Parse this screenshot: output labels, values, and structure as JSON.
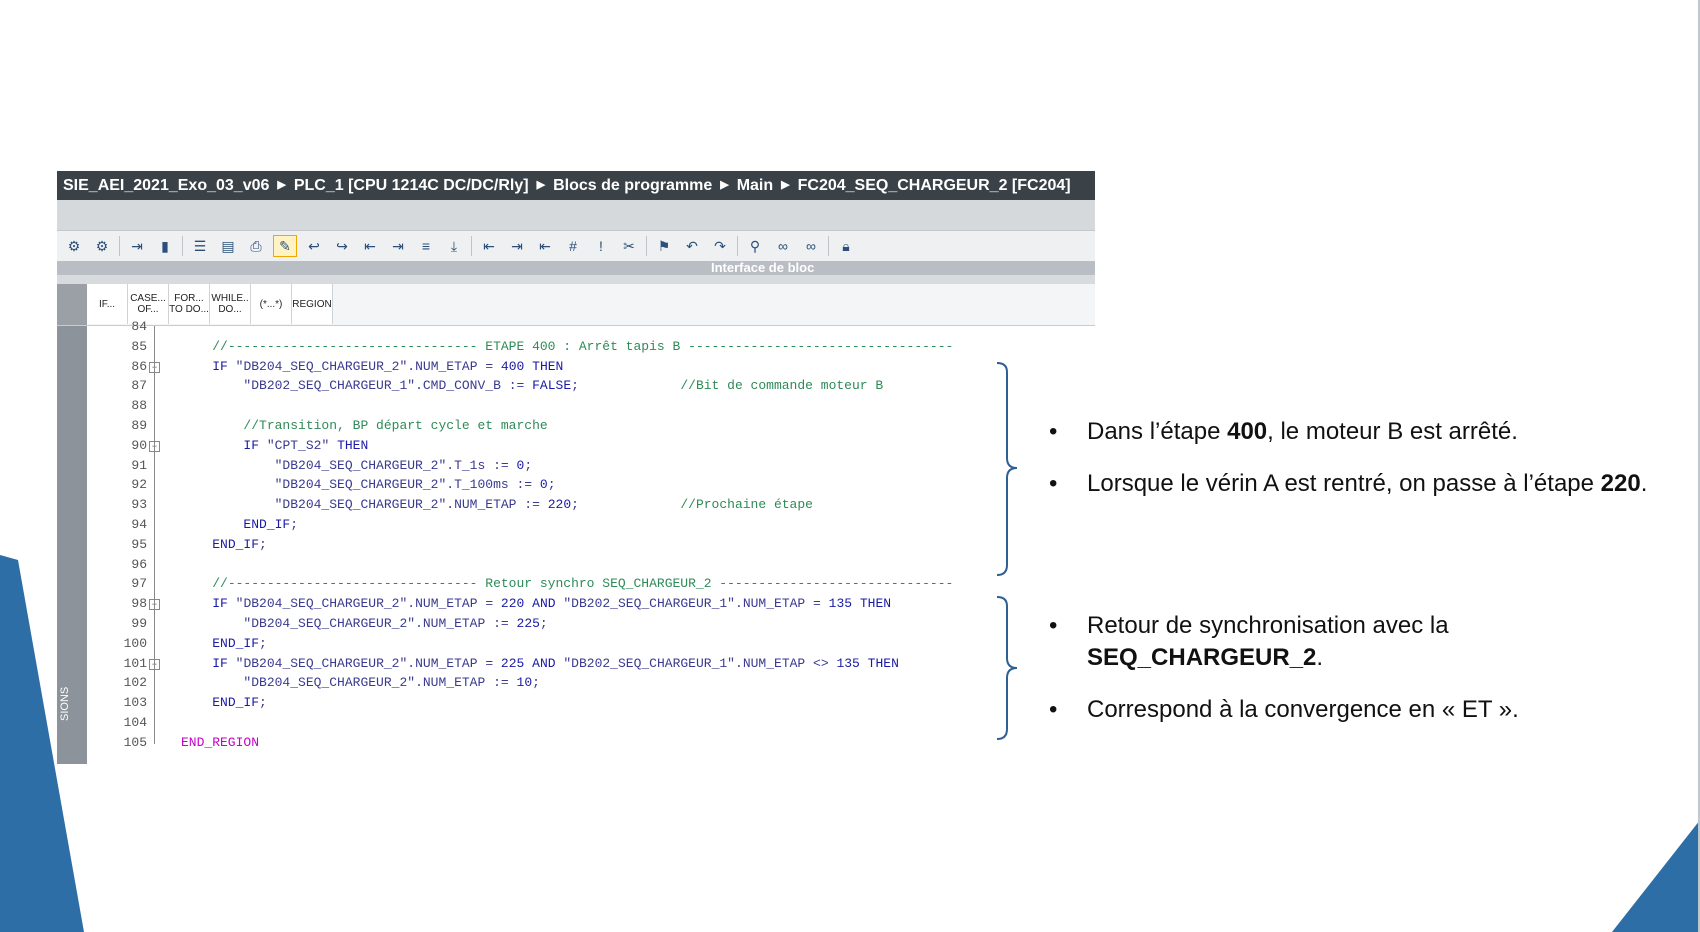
{
  "breadcrumb": [
    "SIE_AEI_2021_Exo_03_v06",
    "PLC_1 [CPU 1214C DC/DC/Rly]",
    "Blocs de programme",
    "Main",
    "FC204_SEQ_CHARGEUR_2 [FC204]"
  ],
  "interface_label": "Interface de bloc",
  "snippets": [
    "IF...",
    "CASE... OF...",
    "FOR... TO DO...",
    "WHILE.. DO...",
    "(*...*)",
    "REGION"
  ],
  "side_label": "SIONS",
  "code_lines": [
    {
      "n": "84",
      "t": ""
    },
    {
      "n": "85",
      "t": "    //-------------------------------- ETAPE 400 : Arrêt tapis B ----------------------------------"
    },
    {
      "n": "86",
      "t": "    IF \"DB204_SEQ_CHARGEUR_2\".NUM_ETAP = 400 THEN"
    },
    {
      "n": "87",
      "t": "        \"DB202_SEQ_CHARGEUR_1\".CMD_CONV_B := FALSE;             //Bit de commande moteur B"
    },
    {
      "n": "88",
      "t": ""
    },
    {
      "n": "89",
      "t": "        //Transition, BP départ cycle et marche"
    },
    {
      "n": "90",
      "t": "        IF \"CPT_S2\" THEN"
    },
    {
      "n": "91",
      "t": "            \"DB204_SEQ_CHARGEUR_2\".T_1s := 0;"
    },
    {
      "n": "92",
      "t": "            \"DB204_SEQ_CHARGEUR_2\".T_100ms := 0;"
    },
    {
      "n": "93",
      "t": "            \"DB204_SEQ_CHARGEUR_2\".NUM_ETAP := 220;             //Prochaine étape"
    },
    {
      "n": "94",
      "t": "        END_IF;"
    },
    {
      "n": "95",
      "t": "    END_IF;"
    },
    {
      "n": "96",
      "t": ""
    },
    {
      "n": "97",
      "t": "    //-------------------------------- Retour synchro SEQ_CHARGEUR_2 ------------------------------"
    },
    {
      "n": "98",
      "t": "    IF \"DB204_SEQ_CHARGEUR_2\".NUM_ETAP = 220 AND \"DB202_SEQ_CHARGEUR_1\".NUM_ETAP = 135 THEN"
    },
    {
      "n": "99",
      "t": "        \"DB204_SEQ_CHARGEUR_2\".NUM_ETAP := 225;"
    },
    {
      "n": "100",
      "t": "    END_IF;"
    },
    {
      "n": "101",
      "t": "    IF \"DB204_SEQ_CHARGEUR_2\".NUM_ETAP = 225 AND \"DB202_SEQ_CHARGEUR_1\".NUM_ETAP <> 135 THEN"
    },
    {
      "n": "102",
      "t": "        \"DB204_SEQ_CHARGEUR_2\".NUM_ETAP := 10;"
    },
    {
      "n": "103",
      "t": "    END_IF;"
    },
    {
      "n": "104",
      "t": ""
    },
    {
      "n": "105",
      "t": "END_REGION"
    }
  ],
  "bullets": {
    "b1_pre": "Dans l’étape ",
    "b1_bold": "400",
    "b1_post": ", le moteur B est arrêté.",
    "b2_pre": "Lorsque le vérin A est rentré, on passe à l’étape ",
    "b2_bold": "220",
    "b2_post": ".",
    "b3_pre": "Retour de synchronisation avec la ",
    "b3_bold": "SEQ_CHARGEUR_2",
    "b3_post": ".",
    "b4": "Correspond à la convergence en « ET ».",
    "dot": "•"
  },
  "colors": {
    "accent_blue": "#2e6ea6",
    "brace": "#2f5f93",
    "keyword": "#1a1aa6",
    "comment": "#2e8b57",
    "region": "#c600c6"
  }
}
